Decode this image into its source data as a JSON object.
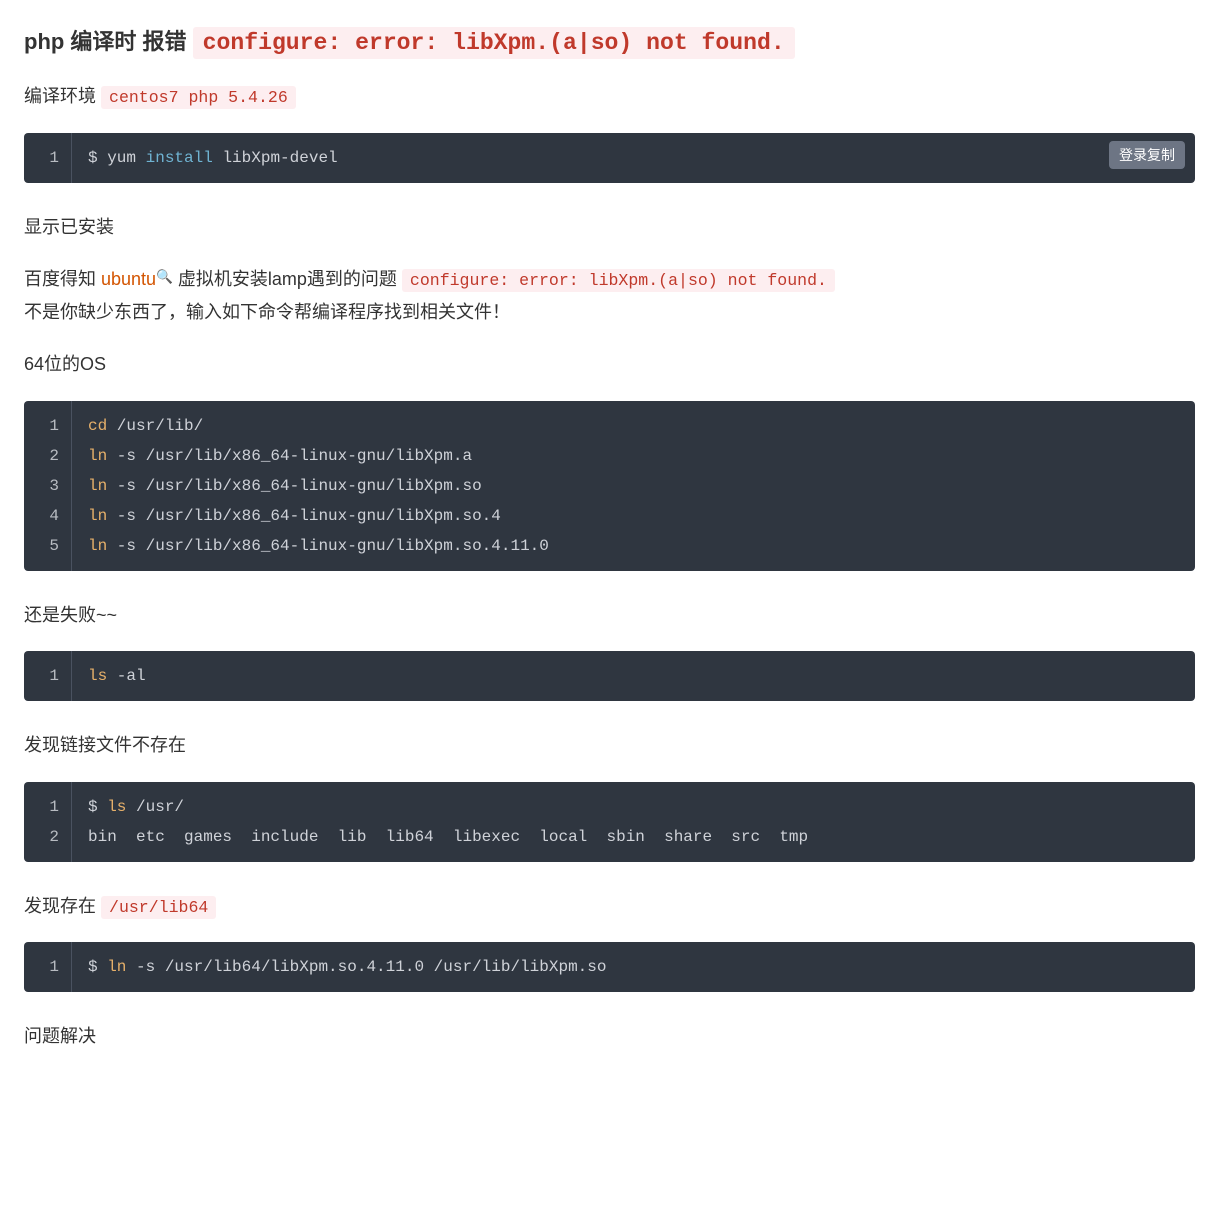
{
  "headline": {
    "prefix": "php 编译时 报错 ",
    "error": "configure: error: libXpm.(a|so) not found."
  },
  "env": {
    "label": "编译环境 ",
    "value": "centos7 php 5.4.26"
  },
  "copy_label": "登录复制",
  "block1": {
    "lines": [
      "1"
    ],
    "code": {
      "prompt": "$ ",
      "cmd1": "yum",
      "kw": " install ",
      "arg": "libXpm-devel"
    }
  },
  "p_installed": "显示已安装",
  "p_baidu": {
    "prefix": "百度得知 ",
    "link": "ubuntu",
    "mid": " 虚拟机安装lamp遇到的问题 ",
    "err": "configure: error: libXpm.(a|so) not found.",
    "line2": "不是你缺少东西了，输入如下命令帮编译程序找到相关文件！"
  },
  "p_64bit": "64位的OS",
  "block2": {
    "lines": [
      "1",
      "2",
      "3",
      "4",
      "5"
    ],
    "rows": [
      {
        "cmd": "cd",
        "rest": " /usr/lib/"
      },
      {
        "cmd": "ln",
        "rest": " -s /usr/lib/x86_64-linux-gnu/libXpm.a"
      },
      {
        "cmd": "ln",
        "rest": " -s /usr/lib/x86_64-linux-gnu/libXpm.so"
      },
      {
        "cmd": "ln",
        "rest": " -s /usr/lib/x86_64-linux-gnu/libXpm.so.4"
      },
      {
        "cmd": "ln",
        "rest": " -s /usr/lib/x86_64-linux-gnu/libXpm.so.4.11.0"
      }
    ]
  },
  "p_fail": "还是失败~~",
  "block3": {
    "lines": [
      "1"
    ],
    "code": {
      "cmd": "ls",
      "rest": " -al"
    }
  },
  "p_notexist": "发现链接文件不存在",
  "block4": {
    "lines": [
      "1",
      "2"
    ],
    "row1": {
      "prompt": "$ ",
      "cmd": "ls",
      "rest": " /usr/"
    },
    "row2": "bin  etc  games  include  lib  lib64  libexec  local  sbin  share  src  tmp"
  },
  "p_found": {
    "prefix": "发现存在 ",
    "code": "/usr/lib64"
  },
  "block5": {
    "lines": [
      "1"
    ],
    "code": {
      "prompt": "$ ",
      "cmd": "ln",
      "rest": " -s /usr/lib64/libXpm.so.4.11.0 /usr/lib/libXpm.so"
    }
  },
  "p_solved": "问题解决"
}
